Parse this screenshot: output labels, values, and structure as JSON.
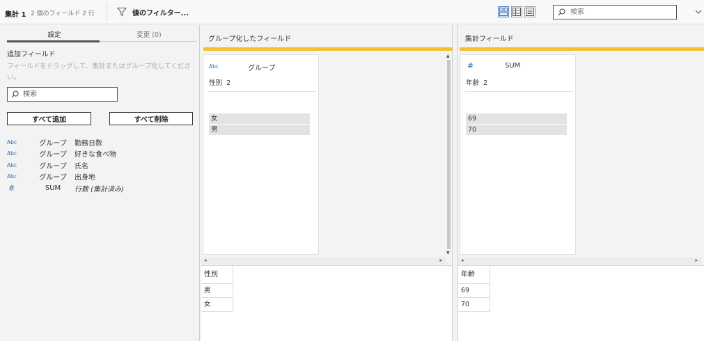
{
  "topbar": {
    "step_title": "集計 1",
    "step_meta": "2 個のフィールド 2 行",
    "filter_label": "値のフィルター...",
    "search_placeholder": "検索"
  },
  "left_panel": {
    "tabs": [
      {
        "label": "設定"
      },
      {
        "label": "変更 (0)"
      }
    ],
    "section_title": "追加フィールド",
    "hint": "フィールドをドラッグして、集計またはグループ化してください。",
    "search_placeholder": "検索",
    "add_all_label": "すべて追加",
    "remove_all_label": "すべて削除",
    "fields": [
      {
        "type": "Abc",
        "agg": "グループ",
        "name": "勤務日数"
      },
      {
        "type": "Abc",
        "agg": "グループ",
        "name": "好きな食べ物"
      },
      {
        "type": "Abc",
        "agg": "グループ",
        "name": "氏名"
      },
      {
        "type": "Abc",
        "agg": "グループ",
        "name": "出身地"
      },
      {
        "type": "#",
        "agg": "SUM",
        "name": "行数 (集計済み)"
      }
    ]
  },
  "grouped_pane": {
    "title": "グループ化したフィールド",
    "card": {
      "type": "Abc",
      "agg": "グループ",
      "field": "性別",
      "count": "2",
      "values": [
        "女",
        "男"
      ]
    },
    "grid": {
      "header": "性別",
      "rows": [
        "男",
        "女"
      ]
    }
  },
  "aggregated_pane": {
    "title": "集計フィールド",
    "card": {
      "type": "#",
      "agg": "SUM",
      "field": "年齢",
      "count": "2",
      "values": [
        "69",
        "70"
      ]
    },
    "grid": {
      "header": "年齢",
      "rows": [
        "69",
        "70"
      ]
    }
  },
  "colors": {
    "accent_bar": "#f0c233",
    "type_icon": "#2f6cb2"
  }
}
